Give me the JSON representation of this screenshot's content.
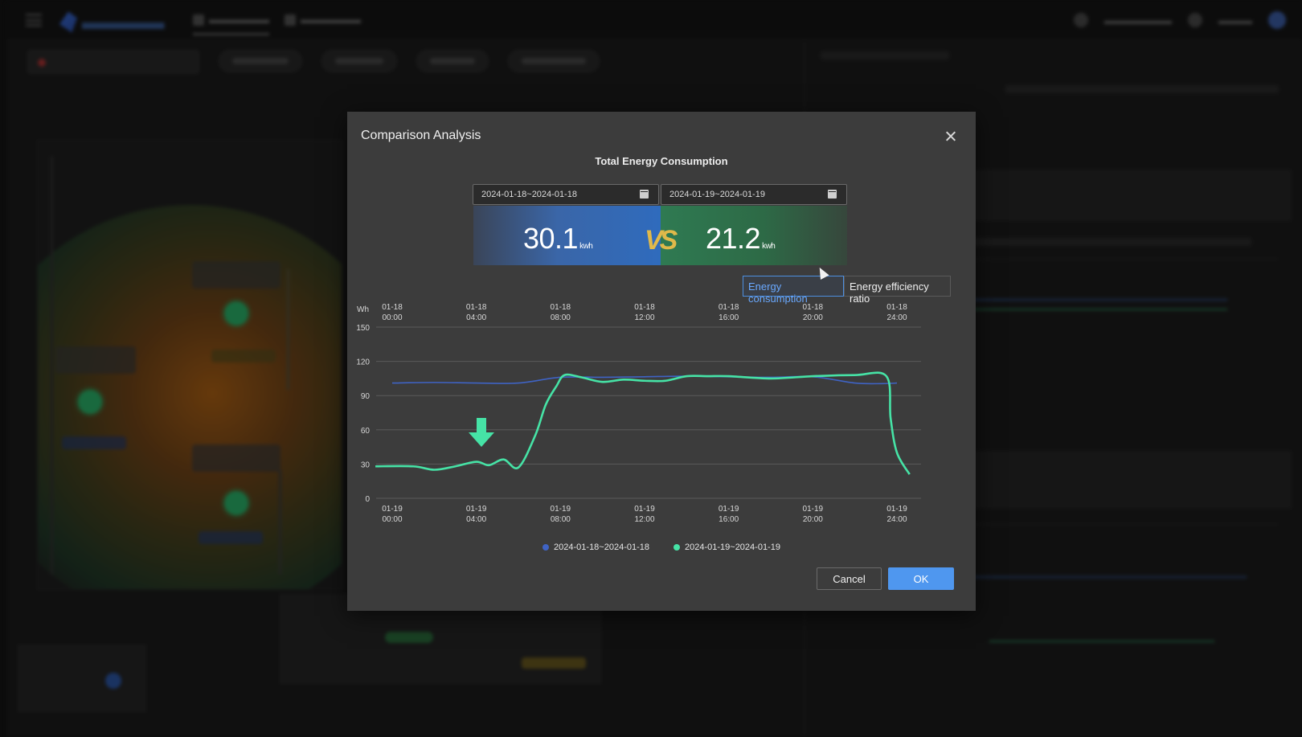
{
  "modal": {
    "title": "Comparison Analysis",
    "subtitle": "Total Energy Consumption",
    "date_range_1": "2024-01-18~2024-01-18",
    "date_range_2": "2024-01-19~2024-01-19",
    "value_1": "30.1",
    "value_2": "21.2",
    "unit": "kwh",
    "vs_label": "VS",
    "toggles": [
      "Energy consumption",
      "Energy efficiency ratio"
    ],
    "cancel_label": "Cancel",
    "ok_label": "OK"
  },
  "colors": {
    "series_1": "#3f63c4",
    "series_2": "#46e3a6",
    "primary": "#4f97ef",
    "active_toggle": "#6aa9ff",
    "vs": "#e0b94a"
  },
  "icons": [
    "close-icon",
    "calendar-icon",
    "down-arrow-icon"
  ],
  "chart_data": {
    "type": "line",
    "ylabel": "Wh",
    "ylim": [
      0,
      150
    ],
    "y_ticks": [
      "150",
      "120",
      "90",
      "60",
      "30",
      "0"
    ],
    "x_top_ticks": [
      [
        "01-18",
        "00:00"
      ],
      [
        "01-18",
        "04:00"
      ],
      [
        "01-18",
        "08:00"
      ],
      [
        "01-18",
        "12:00"
      ],
      [
        "01-18",
        "16:00"
      ],
      [
        "01-18",
        "20:00"
      ],
      [
        "01-18",
        "24:00"
      ]
    ],
    "x_bottom_ticks": [
      [
        "01-19",
        "00:00"
      ],
      [
        "01-19",
        "04:00"
      ],
      [
        "01-19",
        "08:00"
      ],
      [
        "01-19",
        "12:00"
      ],
      [
        "01-19",
        "16:00"
      ],
      [
        "01-19",
        "20:00"
      ],
      [
        "01-19",
        "24:00"
      ]
    ],
    "series": [
      {
        "name": "2024-01-18~2024-01-18",
        "x": [
          0,
          2,
          4,
          6,
          8,
          10,
          12,
          14,
          16,
          18,
          20,
          22,
          23.3,
          24
        ],
        "values": [
          101,
          101.5,
          101,
          101,
          106,
          106,
          106.5,
          107,
          106.5,
          106,
          106.5,
          101,
          100.5,
          101
        ]
      },
      {
        "name": "2024-01-19~2024-01-19",
        "x": [
          -0.8,
          1,
          2,
          3,
          4,
          4.6,
          5.3,
          6,
          6.8,
          7.3,
          7.8,
          8.2,
          9,
          10,
          11,
          12,
          13,
          14,
          15,
          16,
          18,
          20,
          22,
          23.5,
          23.7,
          24,
          24.6
        ],
        "values": [
          28,
          28,
          25,
          28,
          32,
          29,
          34,
          27,
          55,
          82,
          98,
          108,
          106,
          102,
          104,
          103,
          103,
          107,
          107,
          107,
          105,
          107,
          108,
          107,
          70,
          40,
          21
        ]
      }
    ],
    "legend_position": "bottom-center"
  }
}
